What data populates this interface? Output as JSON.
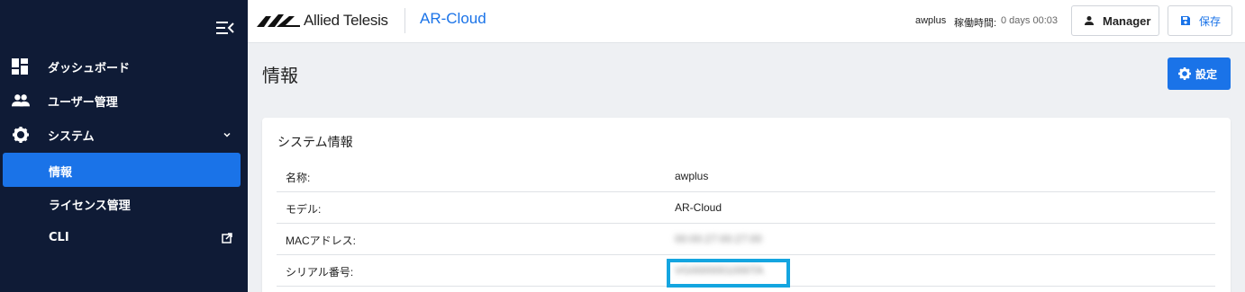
{
  "sidebar": {
    "items": [
      {
        "label": "ダッシュボード",
        "icon": "dashboard-icon"
      },
      {
        "label": "ユーザー管理",
        "icon": "users-icon"
      },
      {
        "label": "システム",
        "icon": "gear-icon"
      }
    ],
    "sub_items": [
      {
        "label": "情報",
        "active": true
      },
      {
        "label": "ライセンス管理",
        "active": false
      },
      {
        "label": "CLI",
        "active": false
      }
    ]
  },
  "header": {
    "brand": "Allied Telesis",
    "app_title": "AR-Cloud",
    "user": "awplus",
    "uptime_label": "稼働時間:",
    "uptime_value": "0 days 00:03",
    "manager_label": "Manager",
    "save_label": "保存"
  },
  "page": {
    "title": "情報",
    "settings_label": "設定"
  },
  "system_info": {
    "title": "システム情報",
    "rows": [
      {
        "key": "名称:",
        "value": "awplus"
      },
      {
        "key": "モデル:",
        "value": "AR-Cloud"
      },
      {
        "key": "MACアドレス:",
        "value": "00:00:27:00:27:00"
      },
      {
        "key": "シリアル番号:",
        "value": "VG0000001000TA"
      }
    ]
  },
  "colors": {
    "sidebar_bg": "#0f1b36",
    "accent": "#1a73e8",
    "highlight": "#14a5e0"
  }
}
